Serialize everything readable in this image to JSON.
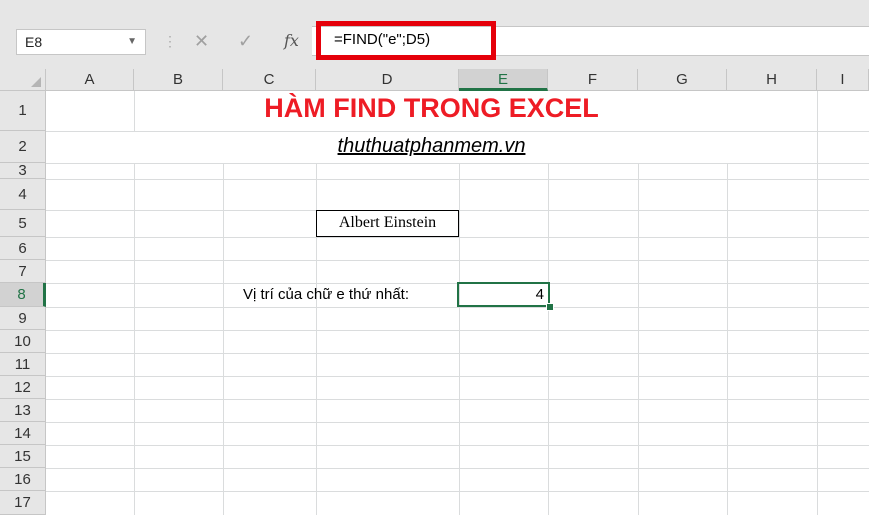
{
  "formula_bar": {
    "name_box": "E8",
    "cancel_icon": "✕",
    "enter_icon": "✓",
    "fx_label": "fx",
    "formula": "=FIND(\"e\";D5)"
  },
  "columns": [
    "A",
    "B",
    "C",
    "D",
    "E",
    "F",
    "G",
    "H",
    "I"
  ],
  "rows": [
    "1",
    "2",
    "3",
    "4",
    "5",
    "6",
    "7",
    "8",
    "9",
    "10",
    "11",
    "12",
    "13",
    "14",
    "15",
    "16",
    "17"
  ],
  "active_cell": {
    "column": "E",
    "row": "8"
  },
  "cells": {
    "title": "HÀM FIND TRONG EXCEL",
    "subtitle": "thuthuatphanmem.vn",
    "D5": "Albert Einstein",
    "C8_label": "Vị trí của chữ e thứ nhất:",
    "E8_value": "4"
  },
  "colors": {
    "title": "#ee1c25",
    "selection": "#217346",
    "highlight": "#e5000a"
  }
}
